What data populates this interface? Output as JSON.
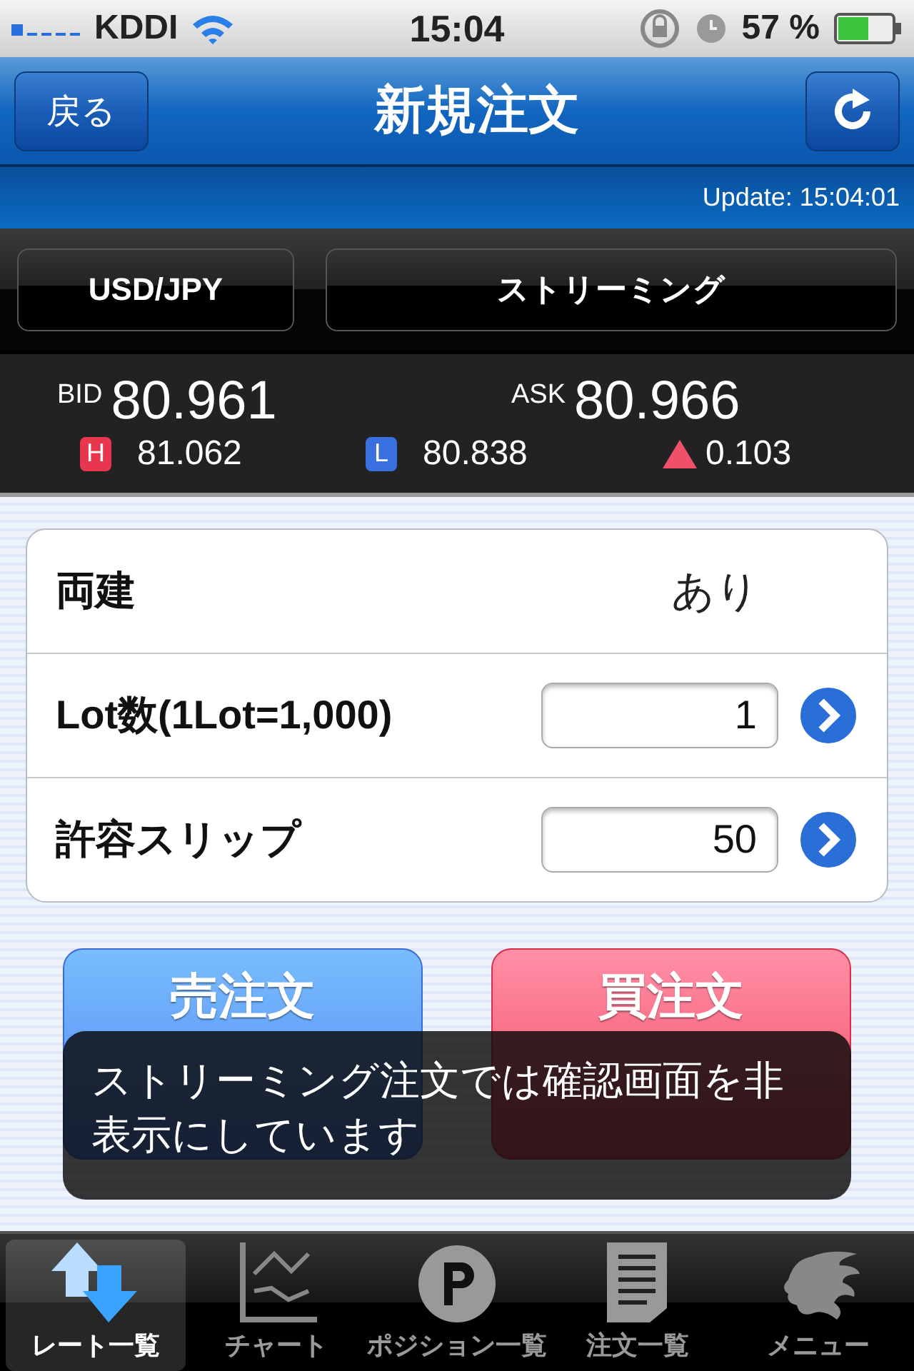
{
  "status_bar": {
    "carrier": "KDDI",
    "time": "15:04",
    "battery": "57 %"
  },
  "nav": {
    "back": "戻る",
    "title": "新規注文"
  },
  "update": "Update: 15:04:01",
  "selectors": [
    "USD/JPY",
    "ストリーミング"
  ],
  "rates": {
    "bid_label": "BID",
    "bid": "80.961",
    "ask_label": "ASK",
    "ask": "80.966",
    "high_badge": "H",
    "high": "81.062",
    "low_badge": "L",
    "low": "80.838",
    "change": "0.103"
  },
  "form": [
    {
      "kind": "value",
      "label": "両建",
      "value": "あり"
    },
    {
      "kind": "input",
      "label": "Lot数(1Lot=1,000)",
      "value": "1"
    },
    {
      "kind": "input",
      "label": "許容スリップ",
      "value": "50"
    }
  ],
  "order_buttons": [
    {
      "kind": "sell",
      "label": "売注文"
    },
    {
      "kind": "buy",
      "label": "買注文"
    }
  ],
  "toast": "ストリーミング注文では確認画面を非表示にしています",
  "tabs": [
    {
      "kind": "rates",
      "label": "レート一覧",
      "selected": true
    },
    {
      "kind": "chart",
      "label": "チャート",
      "selected": false
    },
    {
      "kind": "position",
      "label": "ポジション一覧",
      "selected": false
    },
    {
      "kind": "orders",
      "label": "注文一覧",
      "selected": false
    },
    {
      "kind": "menu",
      "label": "メニュー",
      "selected": false
    }
  ]
}
